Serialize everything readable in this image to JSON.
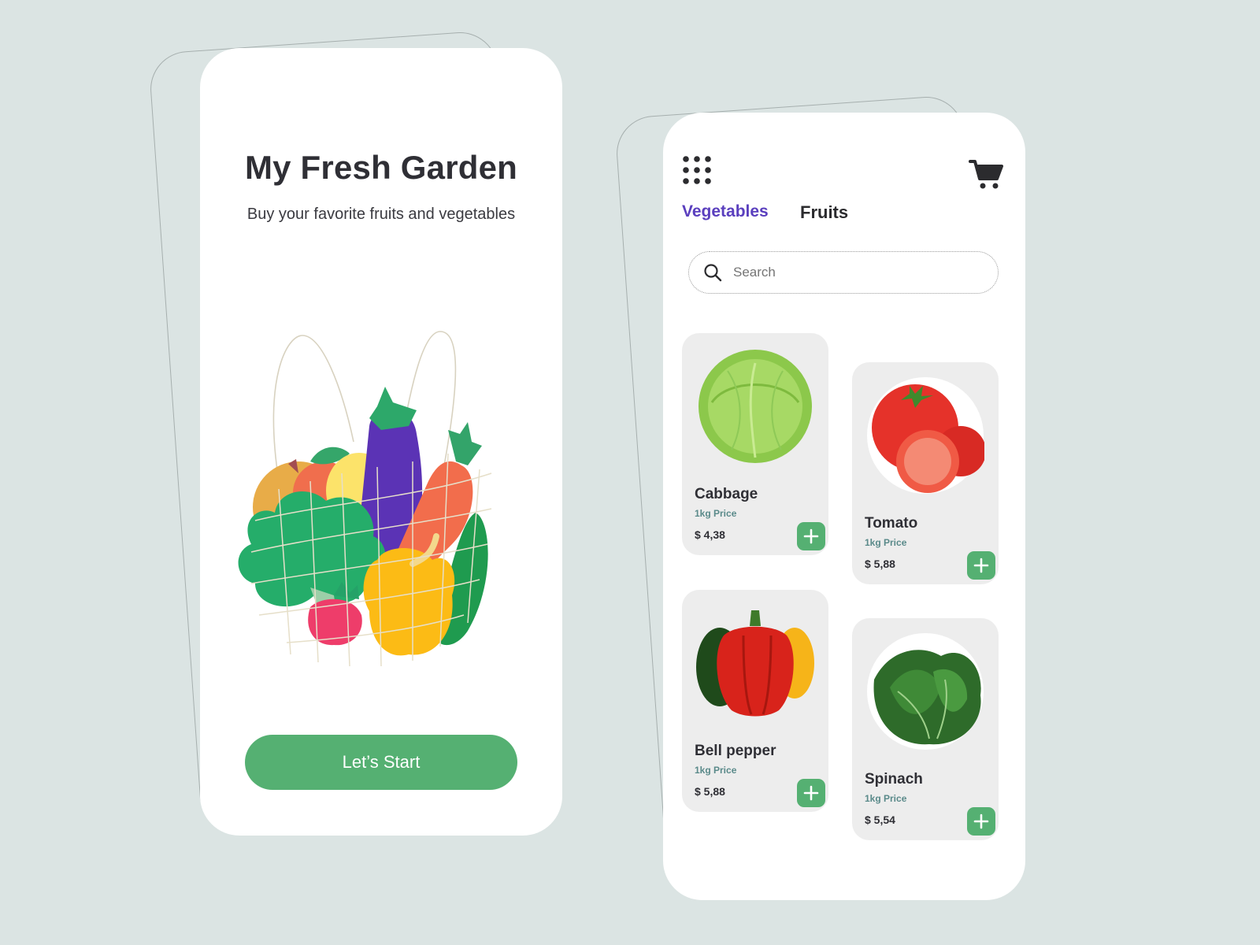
{
  "welcome": {
    "title": "My Fresh Garden",
    "subtitle": "Buy your favorite fruits and vegetables",
    "start_label": "Let’s Start"
  },
  "shop": {
    "tabs": [
      {
        "label": "Vegetables",
        "active": true
      },
      {
        "label": "Fruits",
        "active": false
      }
    ],
    "search": {
      "placeholder": "Search"
    },
    "products": [
      {
        "name": "Cabbage",
        "unit": "1kg Price",
        "price": "$ 4,38",
        "icon": "cabbage"
      },
      {
        "name": "Tomato",
        "unit": "1kg Price",
        "price": "$ 5,88",
        "icon": "tomato"
      },
      {
        "name": "Bell pepper",
        "unit": "1kg Price",
        "price": "$ 5,88",
        "icon": "bell-pepper"
      },
      {
        "name": "Spinach",
        "unit": "1kg Price",
        "price": "$ 5,54",
        "icon": "spinach"
      }
    ]
  },
  "colors": {
    "background": "#dbe4e3",
    "accent_green": "#55b072",
    "active_tab": "#5a3fbe",
    "card": "#ededed"
  }
}
